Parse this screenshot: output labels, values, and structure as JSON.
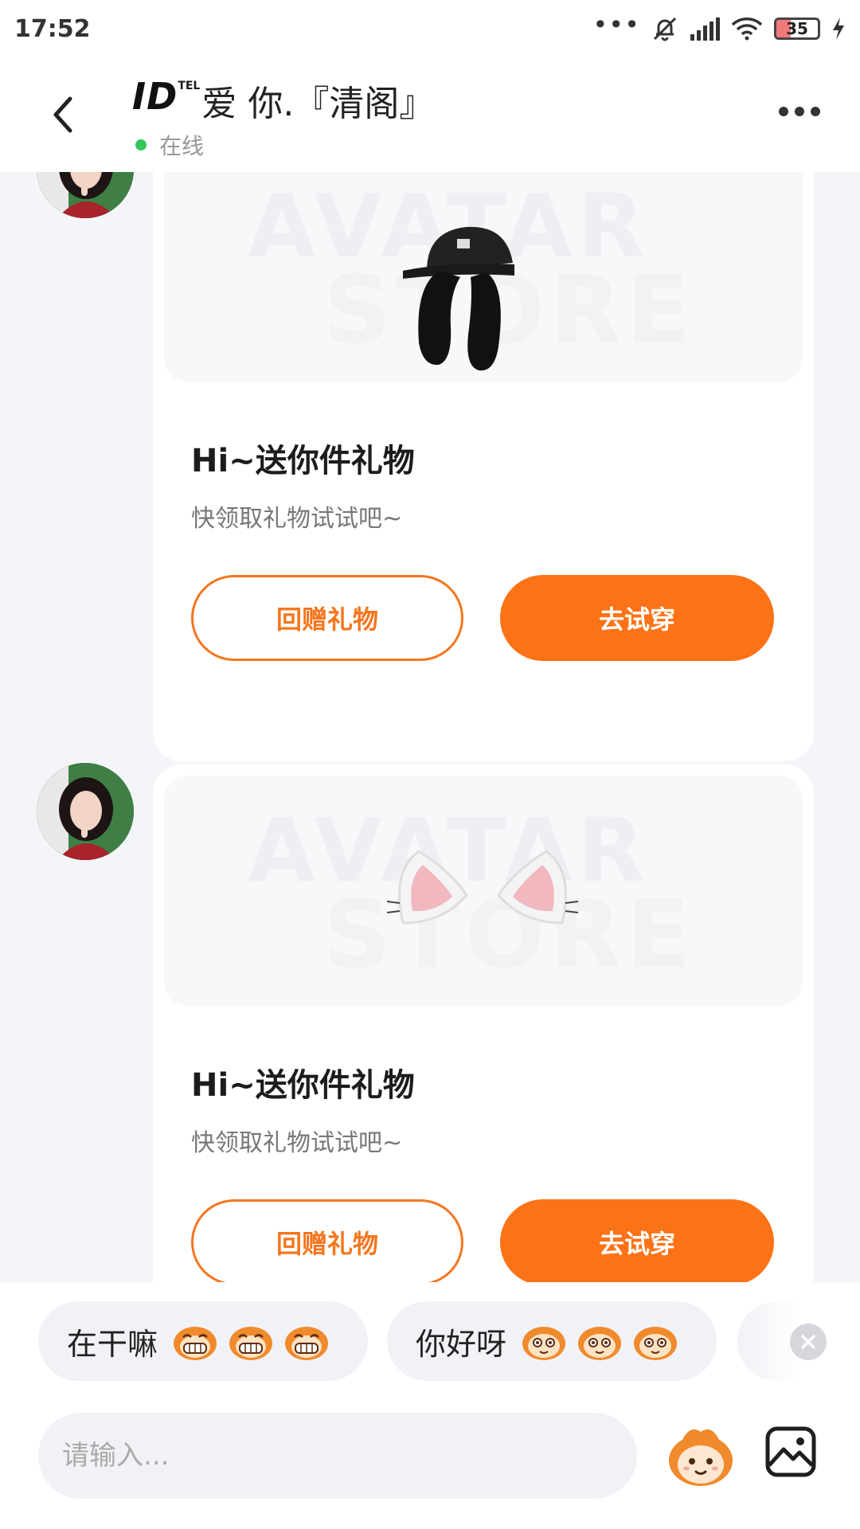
{
  "status_bar": {
    "time": "17:52",
    "battery_percent": 35,
    "battery_label": "35",
    "icons": [
      "more-dots-icon",
      "mute-bell-icon",
      "signal-icon",
      "wifi-icon",
      "battery-icon",
      "charging-bolt-icon"
    ]
  },
  "header": {
    "title_id": "ID",
    "title_sup": "TEL",
    "title_main": "爱 你.『清阁』",
    "status": "在线",
    "back_icon": "chevron-left-icon",
    "more_icon": "more-horizontal-icon"
  },
  "messages": [
    {
      "gift_item": "black bunny-ear cap",
      "watermark_line1": "AVATAR",
      "watermark_line2": "STORE",
      "title": "Hi~送你件礼物",
      "subtitle": "快领取礼物试试吧~",
      "return_gift_label": "回赠礼物",
      "try_on_label": "去试穿"
    },
    {
      "gift_item": "white cat ears",
      "watermark_line1": "AVATAR",
      "watermark_line2": "STORE",
      "title": "Hi~送你件礼物",
      "subtitle": "快领取礼物试试吧~",
      "return_gift_label": "回赠礼物",
      "try_on_label": "去试穿"
    }
  ],
  "quick_replies": [
    {
      "text": "在干嘛",
      "emoji": "grinning-monkey-icon"
    },
    {
      "text": "你好呀",
      "emoji": "smiling-monkey-icon"
    }
  ],
  "input": {
    "placeholder": "请输入...",
    "emoji_button_icon": "mascot-emoji-icon",
    "image_button_icon": "image-icon"
  },
  "colors": {
    "accent": "#fb7316",
    "online": "#35c759",
    "background": "#f4f5f9"
  }
}
